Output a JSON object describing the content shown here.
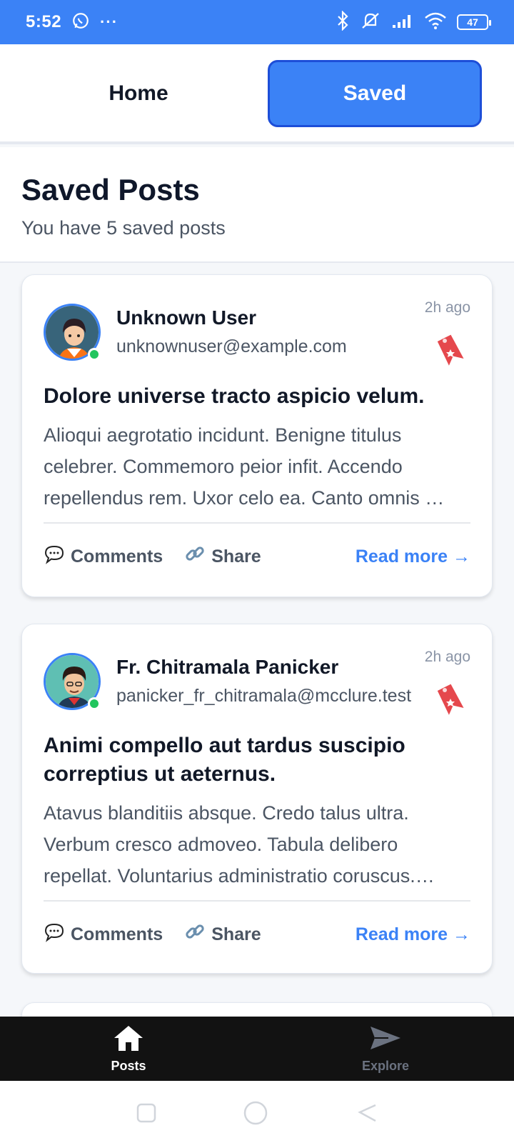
{
  "status_bar": {
    "time": "5:52",
    "battery": "47"
  },
  "tabs": {
    "home": "Home",
    "saved": "Saved"
  },
  "header": {
    "title": "Saved Posts",
    "subtitle": "You have 5 saved posts"
  },
  "posts": [
    {
      "user_name": "Unknown User",
      "user_email": "unknownuser@example.com",
      "time": "2h ago",
      "title": "Dolore universe tracto aspicio velum.",
      "body": "Alioqui aegrotatio incidunt. Benigne titulus celebrer. Commemoro peior infit. Accendo repellendus rem. Uxor celo ea. Canto omnis …",
      "comments_label": "Comments",
      "share_label": "Share",
      "read_more": "Read more →"
    },
    {
      "user_name": "Fr. Chitramala Panicker",
      "user_email": "panicker_fr_chitramala@mcclure.test",
      "time": "2h ago",
      "title": "Animi compello aut tardus suscipio correptius ut aeternus.",
      "body": "Atavus blanditiis absque. Credo talus ultra. Verbum cresco admoveo. Tabula delibero repellat. Voluntarius administratio coruscus.…",
      "comments_label": "Comments",
      "share_label": "Share",
      "read_more": "Read more →"
    }
  ],
  "bottom_nav": {
    "posts": "Posts",
    "explore": "Explore"
  },
  "colors": {
    "accent": "#3b82f6",
    "nav_bg": "#121212",
    "bookmark": "#ef4444"
  }
}
